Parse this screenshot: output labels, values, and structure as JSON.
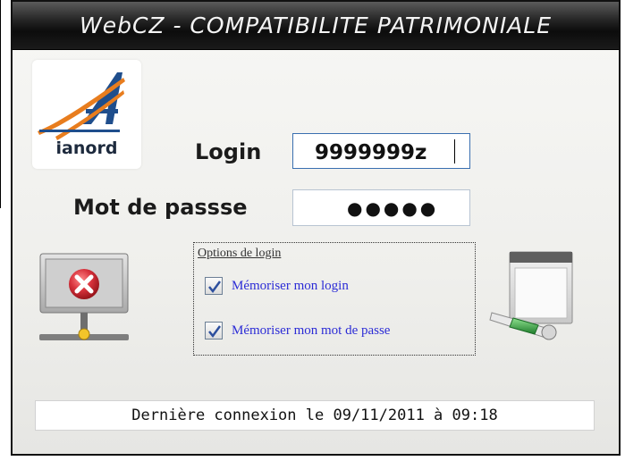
{
  "window": {
    "title": "WebCZ - COMPATIBILITE PATRIMONIALE"
  },
  "logo": {
    "text": "ianord"
  },
  "form": {
    "login_label": "Login",
    "login_value": "9999999z",
    "password_label": "Mot de passse",
    "password_mask": "●●●●●"
  },
  "options": {
    "legend": "Options de login",
    "items": [
      {
        "label": "Mémoriser mon login",
        "checked": true
      },
      {
        "label": "Mémoriser mon mot de passe",
        "checked": true
      }
    ]
  },
  "icons": {
    "cancel": "network-disconnect-icon",
    "connect": "window-connect-icon"
  },
  "status": {
    "last_connection": "Dernière connexion le  09/11/2011 à  09:18"
  },
  "colors": {
    "title_bar": "#1a1a1a",
    "option_text": "#2b2bd6",
    "logo_orange": "#e87d1e",
    "logo_blue": "#1f4e8c",
    "cancel_red": "#d8323c",
    "connect_green": "#3aa649"
  }
}
